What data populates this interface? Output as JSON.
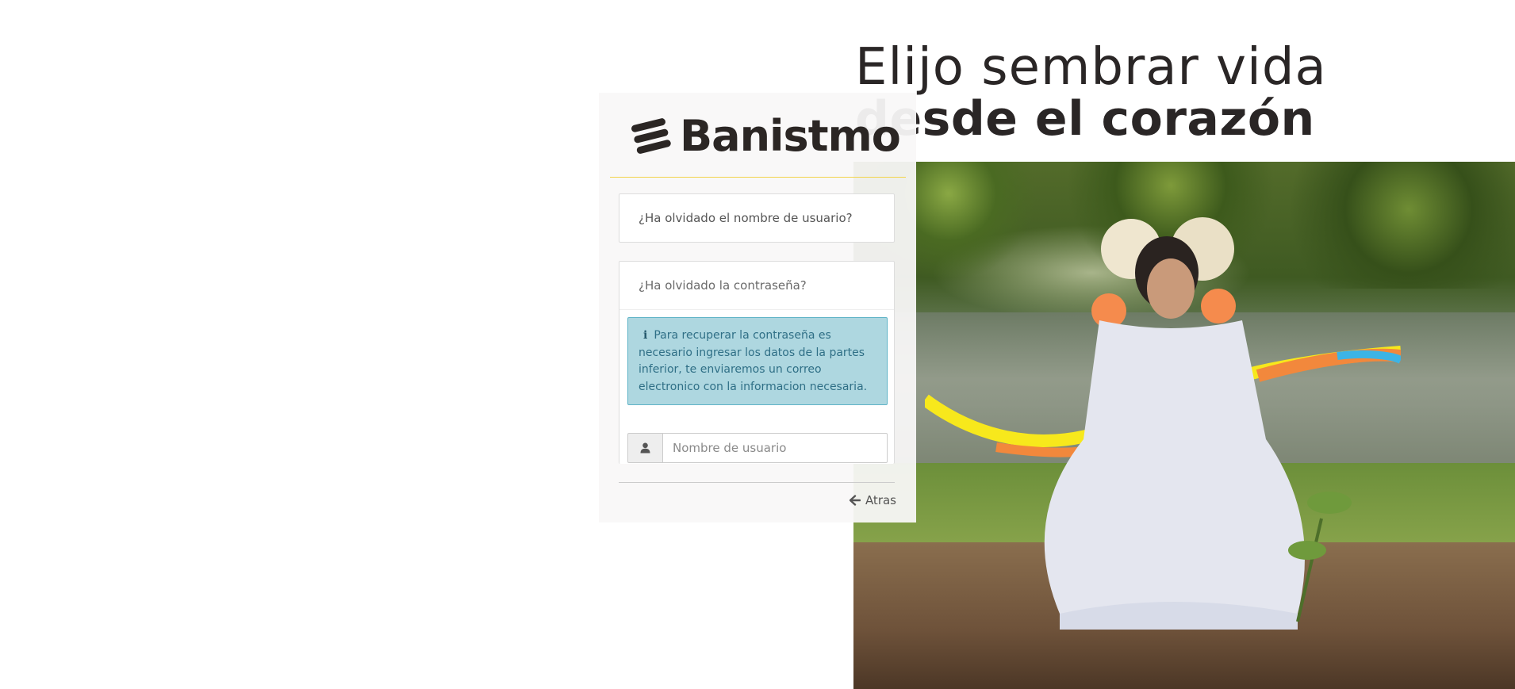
{
  "hero": {
    "line1": "Elijo sembrar vida",
    "line2": "desde el corazón"
  },
  "brand": {
    "name": "Banistmo",
    "accent_color": "#f2d34a"
  },
  "recovery": {
    "username_link": "¿Ha olvidado el nombre de usuario?",
    "password_link": "¿Ha olvidado la contraseña?",
    "info_icon": "info-icon",
    "info_message": "Para recuperar la contraseña es necesario ingresar los datos de la partes inferior, te enviaremos un correo electronico con la informacion necesaria.",
    "username_placeholder": "Nombre de usuario",
    "user_icon": "user-icon"
  },
  "nav": {
    "back_label": "Atras",
    "back_icon": "arrow-left-icon"
  },
  "colors": {
    "info_bg": "#aed7e0",
    "info_border": "#5fb4c7",
    "info_text": "#2f6f86"
  }
}
